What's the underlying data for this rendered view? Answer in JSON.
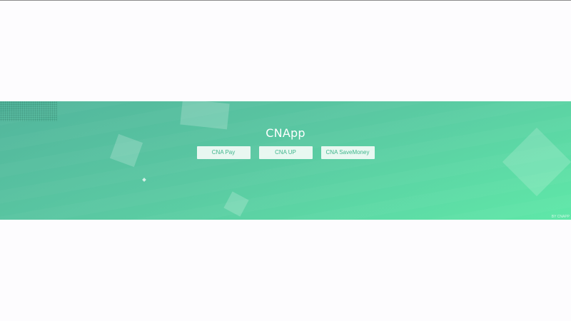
{
  "header": {
    "title": "CNApp"
  },
  "buttons": [
    {
      "label": "CNA Pay"
    },
    {
      "label": "CNA UP"
    },
    {
      "label": "CNA SaveMoney"
    }
  ],
  "footer": {
    "credit": "BY CNAPP"
  },
  "theme": {
    "gradient_start": "#52b59c",
    "gradient_end": "#5fe8a8",
    "button_text": "#3fb58c",
    "page_background": "#fdfcfe"
  }
}
